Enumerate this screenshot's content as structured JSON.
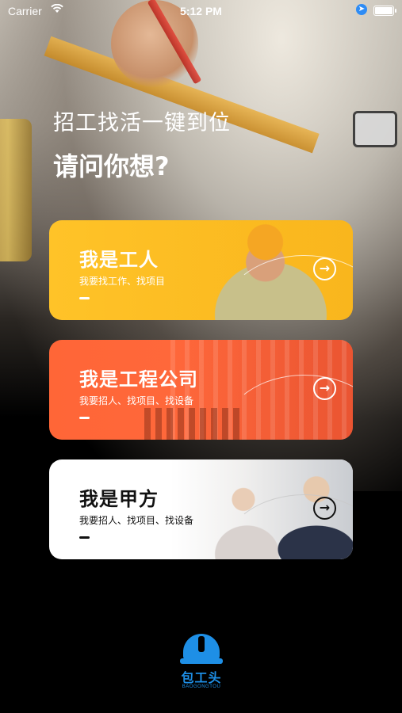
{
  "status_bar": {
    "carrier": "Carrier",
    "time": "5:12 PM"
  },
  "headline": "招工找活一键到位",
  "question": "请问你想?",
  "cards": [
    {
      "title": "我是工人",
      "subtitle": "我要找工作、找项目",
      "arrow": "→",
      "color": "#FBB91F"
    },
    {
      "title": "我是工程公司",
      "subtitle": "我要招人、找项目、找设备",
      "arrow": "→",
      "color": "#FF6637"
    },
    {
      "title": "我是甲方",
      "subtitle": "我要招人、找项目、找设备",
      "arrow": "→",
      "color": "#FFFFFF"
    }
  ],
  "logo": {
    "name": "包工头",
    "name_en": "BAOGONGTOU",
    "color": "#1E8FE6"
  }
}
